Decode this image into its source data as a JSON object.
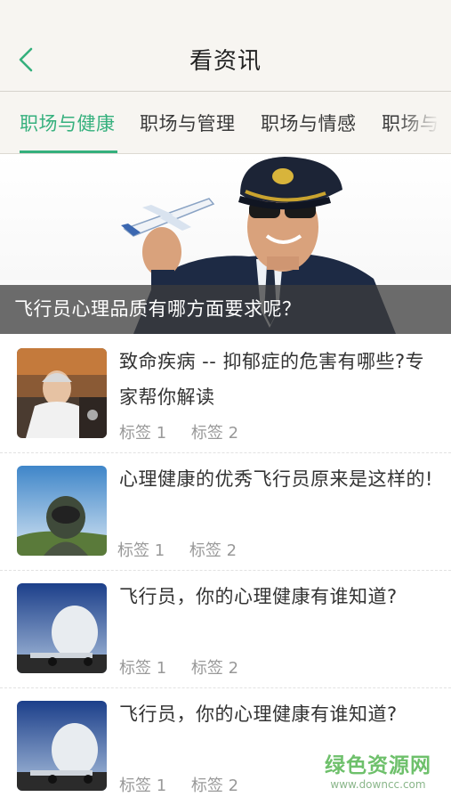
{
  "header": {
    "title": "看资讯"
  },
  "tabs": [
    {
      "label": "职场与健康"
    },
    {
      "label": "职场与管理"
    },
    {
      "label": "职场与情感"
    },
    {
      "label": "职场与"
    }
  ],
  "banner": {
    "caption": "飞行员心理品质有哪方面要求呢？"
  },
  "articles": [
    {
      "title": "致命疾病 -- 抑郁症的危害有哪些?专家帮你解读",
      "tags": [
        "标签 1",
        "标签 2"
      ]
    },
    {
      "title": "心理健康的优秀飞行员原来是这样的!",
      "tags": [
        "标签 1",
        "标签 2"
      ]
    },
    {
      "title": "飞行员，你的心理健康有谁知道?",
      "tags": [
        "标签 1",
        "标签 2"
      ]
    },
    {
      "title": "飞行员，你的心理健康有谁知道?",
      "tags": [
        "标签 1",
        "标签 2"
      ]
    }
  ],
  "watermark": {
    "main": "绿色资源网",
    "sub": "www.downcc.com"
  },
  "colors": {
    "accent": "#35b07d",
    "header_bg": "#f7f5f1"
  }
}
